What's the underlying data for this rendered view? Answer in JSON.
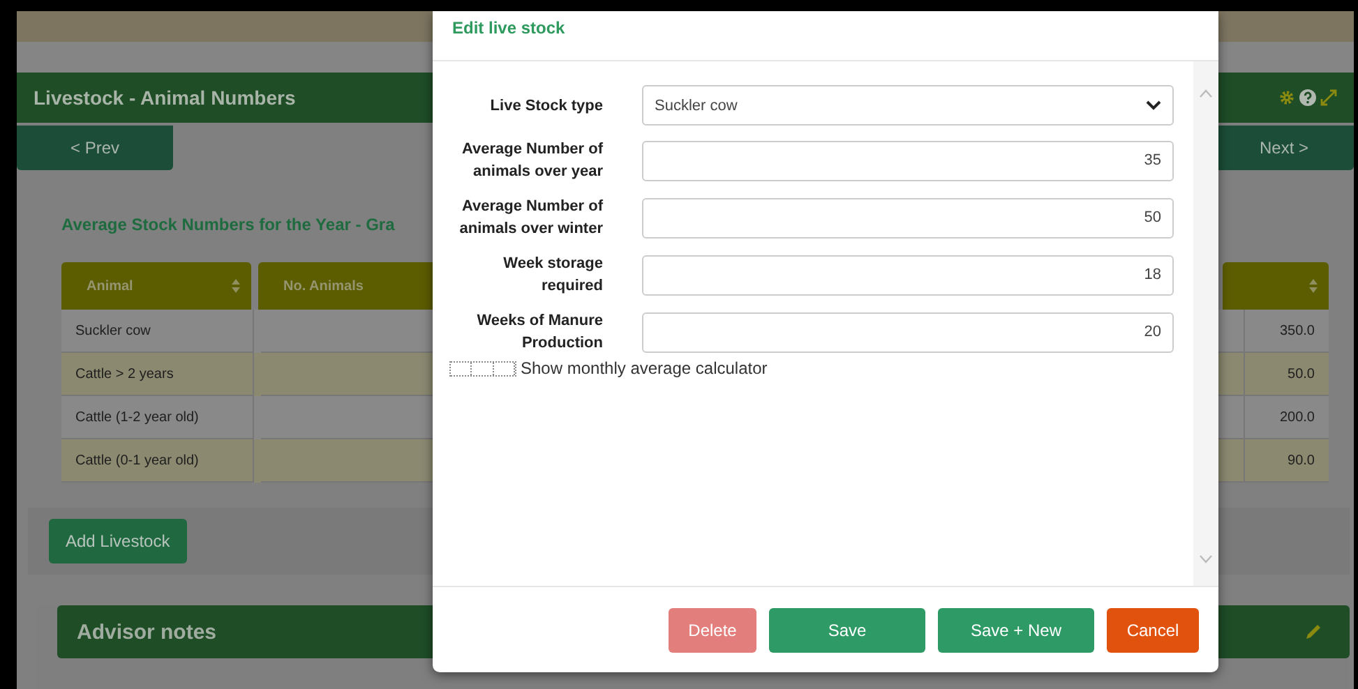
{
  "page": {
    "title": "Livestock - Animal Numbers",
    "prev_button": "< Prev",
    "next_button": "Next >",
    "subtitle": "Average Stock Numbers for the Year - Gra"
  },
  "table": {
    "columns": [
      {
        "label": "Animal"
      },
      {
        "label": "No. Animals"
      }
    ],
    "rows": [
      {
        "animal": "Suckler cow",
        "column_3": "350.0"
      },
      {
        "animal": "Cattle > 2 years",
        "column_3": "50.0"
      },
      {
        "animal": "Cattle (1-2 year old)",
        "column_3": "200.0"
      },
      {
        "animal": "Cattle (0-1 year old)",
        "column_3": "90.0"
      }
    ]
  },
  "add_button": "Add Livestock",
  "advisor_notes": {
    "title": "Advisor notes"
  },
  "modal": {
    "title": "Edit live stock",
    "fields": [
      {
        "kind": "select",
        "label": "Live Stock type",
        "value": "Suckler cow"
      },
      {
        "kind": "number",
        "label": "Average Number of animals over year",
        "value": "35"
      },
      {
        "kind": "number",
        "label": "Average Number of animals over winter",
        "value": "50"
      },
      {
        "kind": "number",
        "label": "Week storage required",
        "value": "18"
      },
      {
        "kind": "number",
        "label": "Weeks of Manure Production",
        "value": "20"
      }
    ],
    "checkbox": {
      "label": "Show monthly average calculator",
      "checked": false
    },
    "buttons": [
      {
        "kind": "danger",
        "label": "Delete",
        "disabled": true
      },
      {
        "kind": "primary",
        "label": "Save",
        "disabled": false
      },
      {
        "kind": "primary",
        "label": "Save + New",
        "disabled": false
      },
      {
        "kind": "warning",
        "label": "Cancel",
        "disabled": false
      }
    ]
  }
}
